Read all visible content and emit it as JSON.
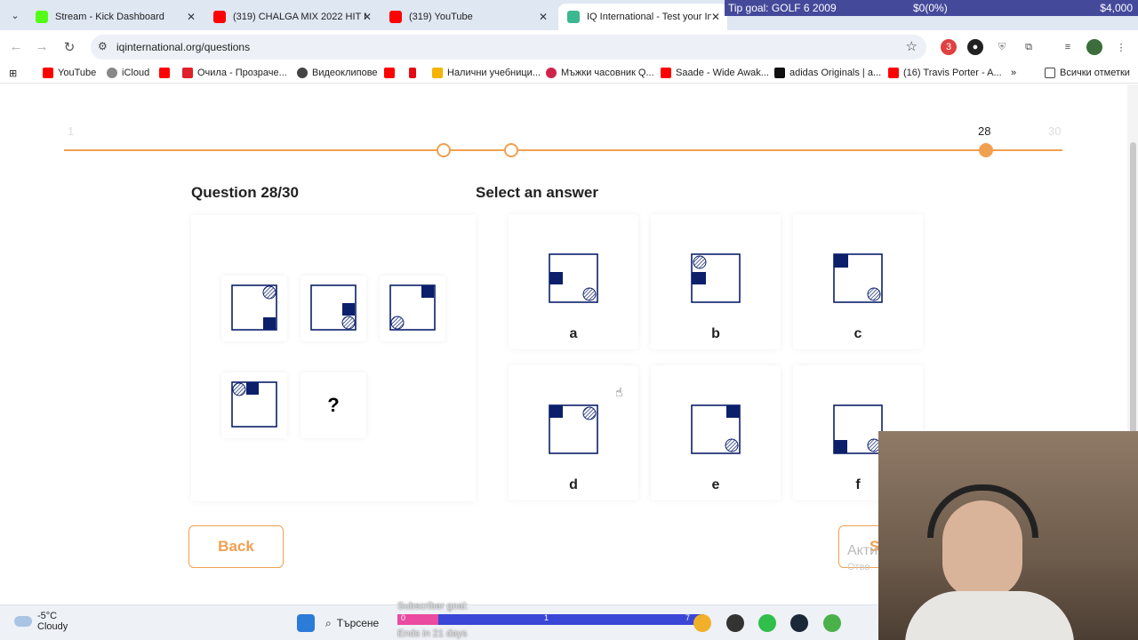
{
  "tabs": [
    {
      "title": "Stream - Kick Dashboard",
      "icon": "kick-icon",
      "color": "#53fc18"
    },
    {
      "title": "(319) CHALGA MIX 2022 HIT M",
      "icon": "youtube-icon",
      "color": "#ff0000"
    },
    {
      "title": "(319) YouTube",
      "icon": "youtube-icon",
      "color": "#ff0000"
    },
    {
      "title": "IQ International - Test your Inte",
      "icon": "iq-icon",
      "color": "#3bb88f"
    }
  ],
  "overlay": {
    "tip_goal": "Tip goal: GOLF 6 2009",
    "progress": "$0(0%)",
    "target": "$4,000"
  },
  "address": {
    "url": "iqinternational.org/questions"
  },
  "extensions": {
    "badge": "3"
  },
  "bookmarks": [
    {
      "label": "YouTube",
      "color": "#ff0000"
    },
    {
      "label": "iCloud",
      "color": "#888888"
    },
    {
      "label": "",
      "color": "#ff0000"
    },
    {
      "label": "Очила - Прозраче...",
      "color": "#e0202a"
    },
    {
      "label": "Видеоклипове",
      "color": "#444444"
    },
    {
      "label": "",
      "color": "#ff0000"
    },
    {
      "label": "",
      "color": "#e50914"
    },
    {
      "label": "Налични учебници...",
      "color": "#f4b400"
    },
    {
      "label": "Мъжки часовник Q...",
      "color": "#d0234a"
    },
    {
      "label": "Saade - Wide Awak...",
      "color": "#ff0000"
    },
    {
      "label": "adidas Originals | a...",
      "color": "#111111"
    },
    {
      "label": "(16) Travis Porter - A...",
      "color": "#ff0000"
    }
  ],
  "bookmarks_more": "»",
  "all_bookmarks": "Всички отметки",
  "progress": {
    "start": "1",
    "current": "28",
    "end": "30",
    "current_fraction": 0.93
  },
  "question": {
    "title": "Question 28/30",
    "missing": "?"
  },
  "answers_title": "Select an answer",
  "answers": [
    {
      "label": "a"
    },
    {
      "label": "b"
    },
    {
      "label": "c"
    },
    {
      "label": "d"
    },
    {
      "label": "e"
    },
    {
      "label": "f"
    }
  ],
  "buttons": {
    "back": "Back",
    "submit": "S"
  },
  "activate_windows": {
    "line1": "Акти",
    "line2": "Отво"
  },
  "taskbar": {
    "temp": "-5°C",
    "condition": "Cloudy",
    "search": "Търсене",
    "subscriber_goal": "Subscriber goal:",
    "sub_current": "0",
    "sub_mid": "1",
    "sub_target": "7",
    "ends": "Ends in 21 days"
  },
  "colors": {
    "accent": "#f0a050",
    "shape": "#0b1f6b"
  }
}
